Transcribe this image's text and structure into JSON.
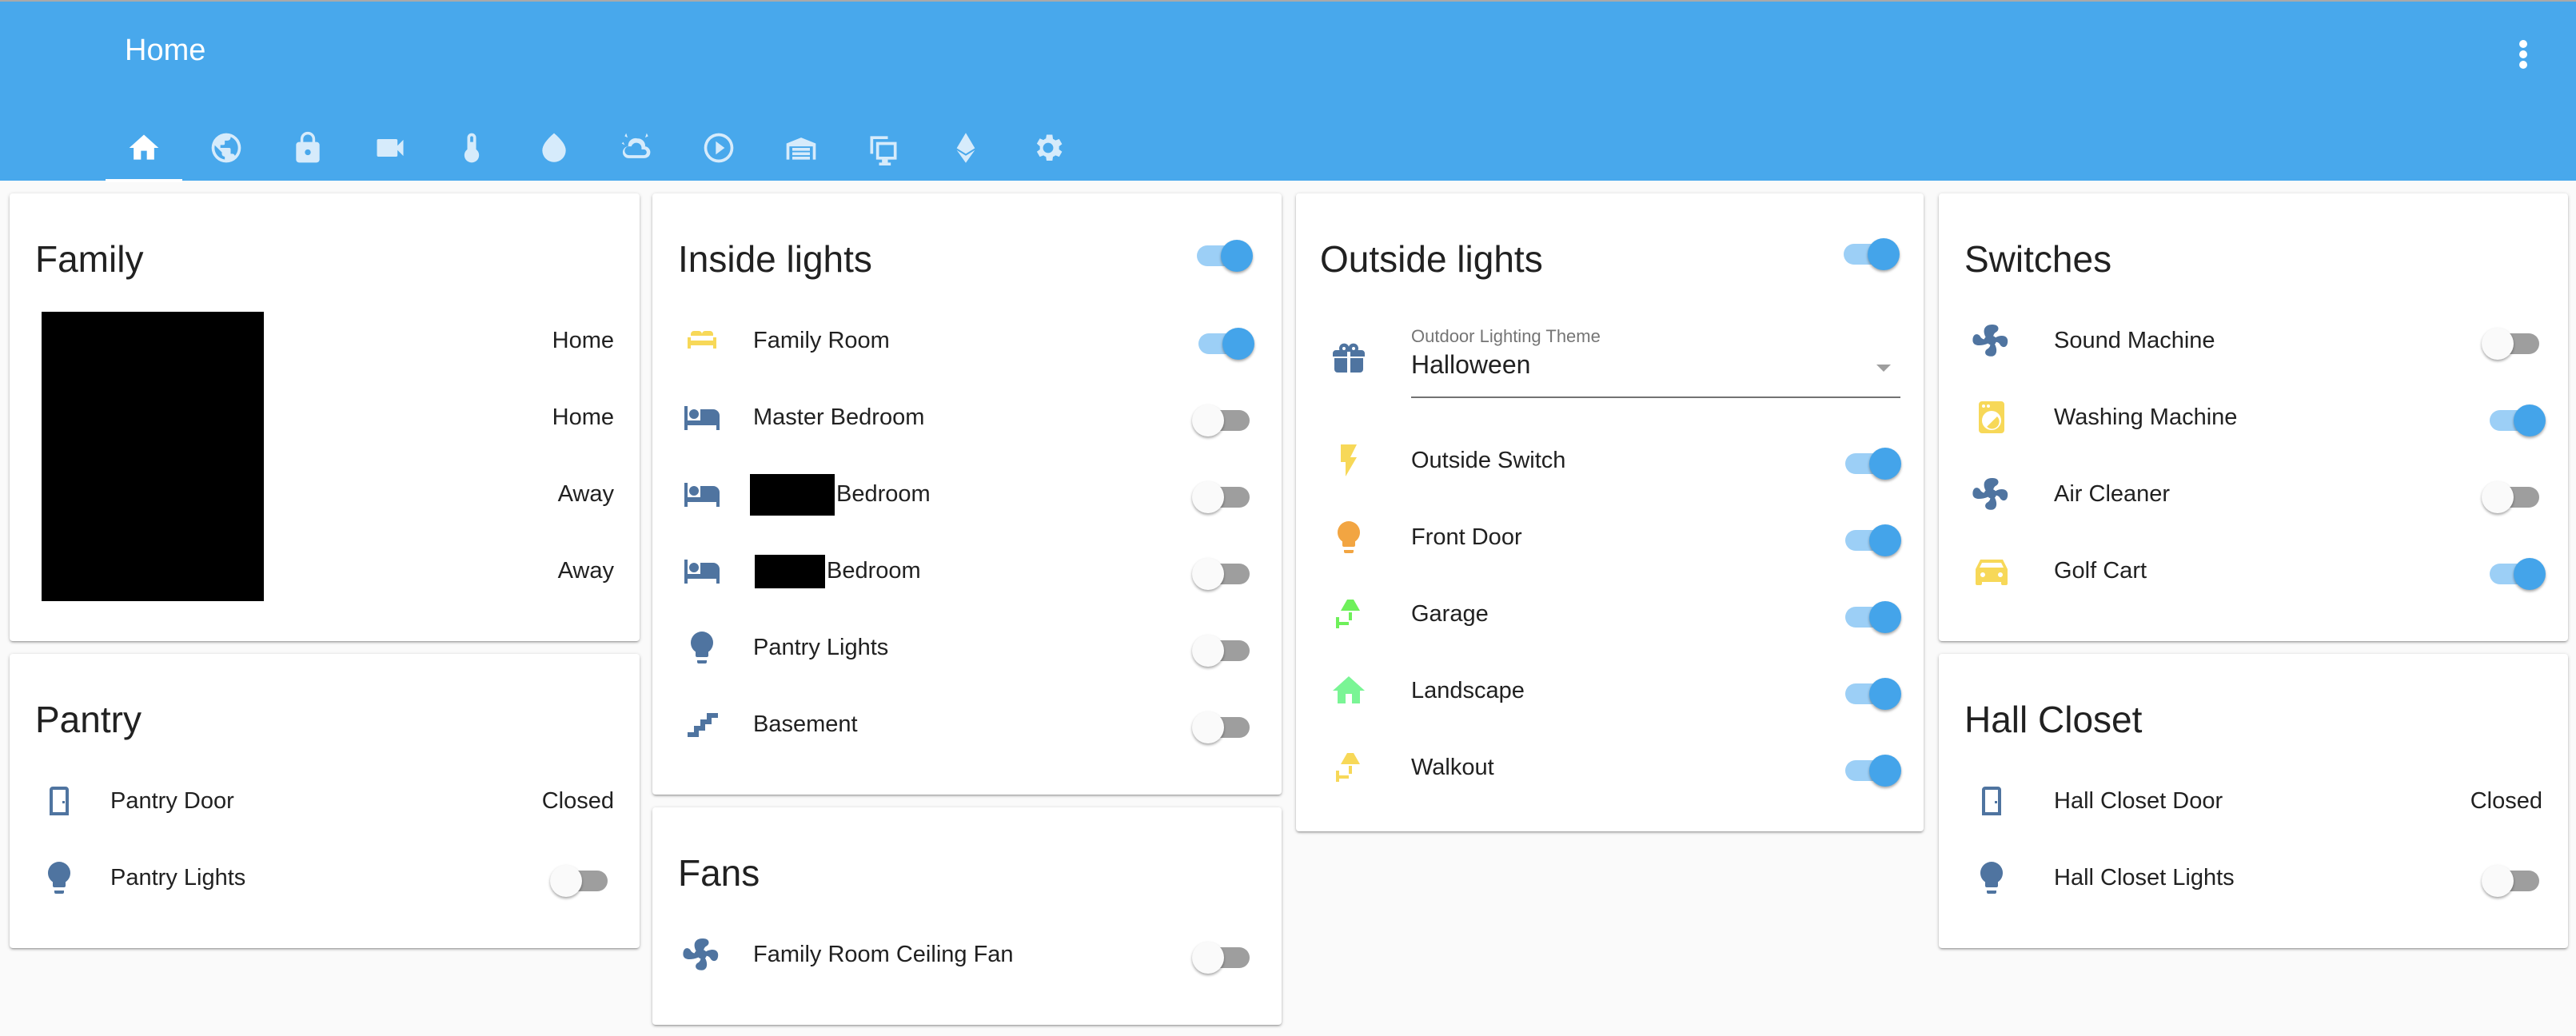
{
  "header": {
    "title": "Home",
    "menu_icon": "dots-vertical-icon",
    "tabs": [
      {
        "icon": "home-icon",
        "active": true
      },
      {
        "icon": "globe-icon",
        "active": false
      },
      {
        "icon": "lock-icon",
        "active": false
      },
      {
        "icon": "video-camera-icon",
        "active": false
      },
      {
        "icon": "thermometer-icon",
        "active": false
      },
      {
        "icon": "water-drop-icon",
        "active": false
      },
      {
        "icon": "weather-partly-cloudy-icon",
        "active": false
      },
      {
        "icon": "play-circle-icon",
        "active": false
      },
      {
        "icon": "garage-icon",
        "active": false
      },
      {
        "icon": "monitor-devices-icon",
        "active": false
      },
      {
        "icon": "ethereum-icon",
        "active": false
      },
      {
        "icon": "settings-icon",
        "active": false
      }
    ]
  },
  "colors": {
    "header": "#48a8ec",
    "toggle_on": "#44a4ea",
    "toggle_on_track": "#9ccff6",
    "toggle_off_track": "#9e9e9e",
    "icon_default": "#4f74a0",
    "icon_yellow": "#f7d858",
    "icon_orange": "#f2a542",
    "icon_green": "#6ef05a",
    "icon_light_green": "#7af595"
  },
  "family": {
    "title": "Family",
    "states": [
      "Home",
      "Home",
      "Away",
      "Away"
    ]
  },
  "pantry": {
    "title": "Pantry",
    "rows": [
      {
        "label": "Pantry Door",
        "icon": "door-icon",
        "state": "Closed"
      },
      {
        "label": "Pantry Lights",
        "icon": "lightbulb-icon",
        "on": false
      }
    ]
  },
  "inside_lights": {
    "title": "Inside lights",
    "all_on": true,
    "rows": [
      {
        "label": "Family Room",
        "icon": "sofa-icon",
        "on": true,
        "redacted": false
      },
      {
        "label": "Master Bedroom",
        "icon": "bed-icon",
        "on": false,
        "redacted": false
      },
      {
        "label": "Bedroom",
        "icon": "bed-icon",
        "on": false,
        "redacted": true
      },
      {
        "label": "Bedroom",
        "icon": "bed-icon",
        "on": false,
        "redacted": true
      },
      {
        "label": "Pantry Lights",
        "icon": "lightbulb-icon",
        "on": false,
        "redacted": false
      },
      {
        "label": "Basement",
        "icon": "stairs-icon",
        "on": false,
        "redacted": false
      }
    ]
  },
  "fans": {
    "title": "Fans",
    "rows": [
      {
        "label": "Family Room Ceiling Fan",
        "icon": "fan-icon",
        "on": false
      }
    ]
  },
  "outside_lights": {
    "title": "Outside lights",
    "all_on": true,
    "theme_select": {
      "label": "Outdoor Lighting Theme",
      "value": "Halloween",
      "icon": "gift-icon"
    },
    "rows": [
      {
        "label": "Outside Switch",
        "icon": "flash-icon",
        "on": true
      },
      {
        "label": "Front Door",
        "icon": "lightbulb-icon",
        "on": true
      },
      {
        "label": "Garage",
        "icon": "outdoor-lamp-icon",
        "on": true
      },
      {
        "label": "Landscape",
        "icon": "home-icon",
        "on": true
      },
      {
        "label": "Walkout",
        "icon": "outdoor-lamp-icon",
        "on": true
      }
    ]
  },
  "switches": {
    "title": "Switches",
    "rows": [
      {
        "label": "Sound Machine",
        "icon": "fan-icon",
        "on": false
      },
      {
        "label": "Washing Machine",
        "icon": "washing-machine-icon",
        "on": true
      },
      {
        "label": "Air Cleaner",
        "icon": "fan-icon",
        "on": false
      },
      {
        "label": "Golf Cart",
        "icon": "car-icon",
        "on": true
      }
    ]
  },
  "hall_closet": {
    "title": "Hall Closet",
    "rows": [
      {
        "label": "Hall Closet Door",
        "icon": "door-icon",
        "state": "Closed"
      },
      {
        "label": "Hall Closet Lights",
        "icon": "lightbulb-icon",
        "on": false
      }
    ]
  }
}
